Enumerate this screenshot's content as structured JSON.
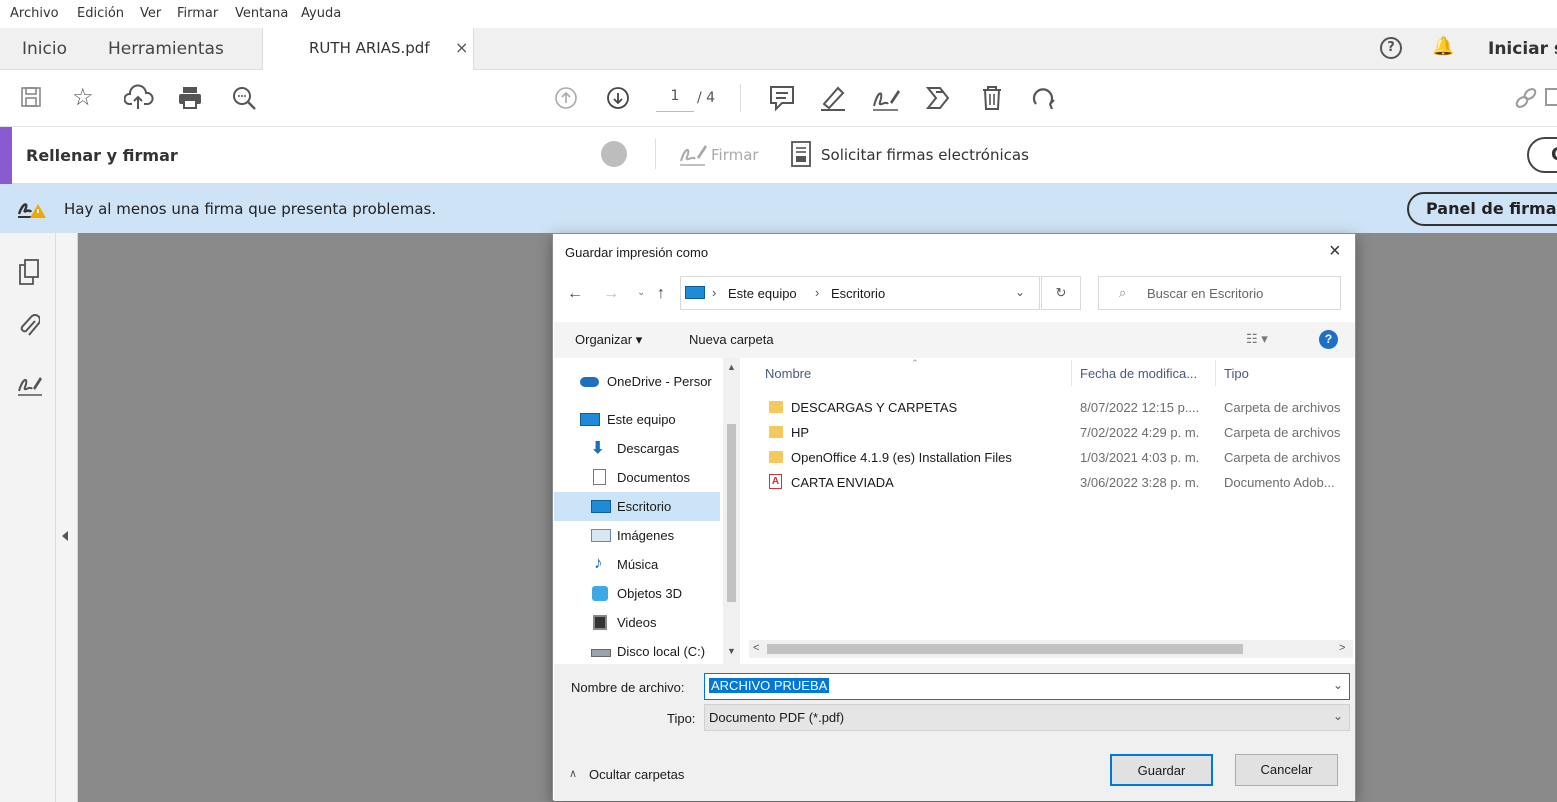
{
  "menu": [
    "Archivo",
    "Edición",
    "Ver",
    "Firmar",
    "Ventana",
    "Ayuda"
  ],
  "tabs": {
    "home": "Inicio",
    "tools": "Herramientas",
    "document": "RUTH ARIAS.pdf",
    "close": "×",
    "sign_in": "Iniciar s"
  },
  "toolbar": {
    "page_current": "1",
    "page_total": "/ 4"
  },
  "fill_sign": {
    "title": "Rellenar y firmar",
    "sign_label": "Firmar",
    "request_label": "Solicitar firmas electrónicas"
  },
  "warning": {
    "text": "Hay al menos una firma que presenta problemas.",
    "panel_button": "Panel de firma"
  },
  "dialog": {
    "title": "Guardar impresión como",
    "close": "×",
    "breadcrumb": [
      "Este equipo",
      "Escritorio"
    ],
    "search_placeholder": "Buscar en Escritorio",
    "organize": "Organizar ▾",
    "new_folder": "Nueva carpeta",
    "help": "?",
    "tree": [
      {
        "label": "OneDrive - Persor",
        "icon": "cloud-icon"
      },
      {
        "label": "Este equipo",
        "icon": "computer-icon"
      },
      {
        "label": "Descargas",
        "icon": "download-icon"
      },
      {
        "label": "Documentos",
        "icon": "document-icon"
      },
      {
        "label": "Escritorio",
        "icon": "desktop-icon"
      },
      {
        "label": "Imágenes",
        "icon": "image-icon"
      },
      {
        "label": "Música",
        "icon": "music-icon"
      },
      {
        "label": "Objetos 3D",
        "icon": "cube-icon"
      },
      {
        "label": "Videos",
        "icon": "video-icon"
      },
      {
        "label": "Disco local (C:)",
        "icon": "drive-icon"
      }
    ],
    "columns": {
      "name": "Nombre",
      "date": "Fecha de modifica...",
      "type": "Tipo"
    },
    "files": [
      {
        "name": "DESCARGAS Y CARPETAS",
        "date": "8/07/2022 12:15 p....",
        "type": "Carpeta de archivos",
        "kind": "folder"
      },
      {
        "name": "HP",
        "date": "7/02/2022 4:29 p. m.",
        "type": "Carpeta de archivos",
        "kind": "folder"
      },
      {
        "name": "OpenOffice 4.1.9 (es) Installation Files",
        "date": "1/03/2021 4:03 p. m.",
        "type": "Carpeta de archivos",
        "kind": "folder"
      },
      {
        "name": "CARTA ENVIADA",
        "date": "3/06/2022 3:28 p. m.",
        "type": "Documento Adob...",
        "kind": "pdf"
      }
    ],
    "filename_label": "Nombre de archivo:",
    "filename_value": "ARCHIVO PRUEBA",
    "type_label": "Tipo:",
    "type_value": "Documento PDF (*.pdf)",
    "hide_folders": "Ocultar carpetas",
    "save": "Guardar",
    "cancel": "Cancelar"
  },
  "colors": {
    "accent": "#8a5bd0",
    "warning_bg": "#cfe3f6",
    "selection": "#0078d7",
    "tree_selected": "#cce4f7"
  }
}
